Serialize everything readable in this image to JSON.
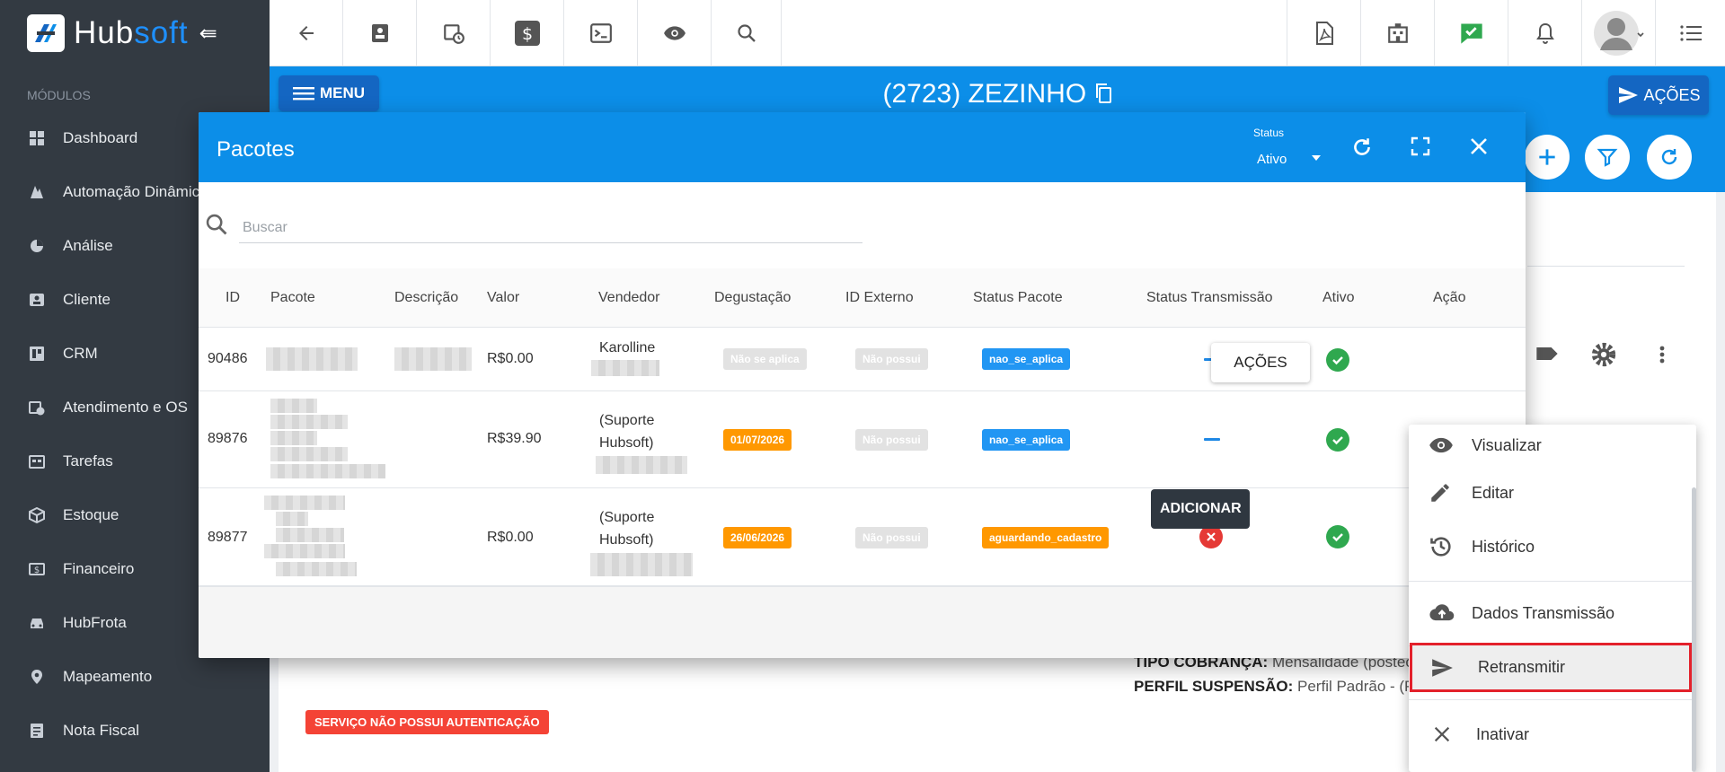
{
  "brand": {
    "name_a": "Hub",
    "name_b": "soft"
  },
  "sidebar": {
    "section": "MÓDULOS",
    "items": [
      {
        "label": "Dashboard",
        "icon": "dashboard-icon"
      },
      {
        "label": "Automação Dinâmica",
        "icon": "automation-icon"
      },
      {
        "label": "Análise",
        "icon": "pie-chart-icon"
      },
      {
        "label": "Cliente",
        "icon": "client-card-icon"
      },
      {
        "label": "CRM",
        "icon": "crm-board-icon"
      },
      {
        "label": "Atendimento e OS",
        "icon": "calendar-clock-icon"
      },
      {
        "label": "Tarefas",
        "icon": "tasks-icon"
      },
      {
        "label": "Estoque",
        "icon": "box-icon"
      },
      {
        "label": "Financeiro",
        "icon": "money-icon"
      },
      {
        "label": "HubFrota",
        "icon": "car-icon"
      },
      {
        "label": "Mapeamento",
        "icon": "map-pin-icon"
      },
      {
        "label": "Nota Fiscal",
        "icon": "invoice-icon"
      }
    ]
  },
  "header": {
    "menu_label": "MENU",
    "client_title": "(2723) ZEZINHO",
    "acoes_label": "AÇÕES"
  },
  "modal": {
    "title": "Pacotes",
    "status_label": "Status",
    "status_value": "Ativo",
    "search_placeholder": "Buscar",
    "columns": [
      "ID",
      "Pacote",
      "Descrição",
      "Valor",
      "Vendedor",
      "Degustação",
      "ID Externo",
      "Status Pacote",
      "Status Transmissão",
      "Ativo",
      "Ação"
    ],
    "rows": [
      {
        "id": "90486",
        "valor": "R$0.00",
        "vendedor": "Karolline",
        "degustacao": "Não se aplica",
        "id_externo": "Não possui",
        "status_pacote": "nao_se_aplica",
        "acao": "AÇÕES"
      },
      {
        "id": "89876",
        "valor": "R$39.90",
        "vendedor": "(Suporte Hubsoft)",
        "degustacao": "01/07/2026",
        "id_externo": "Não possui",
        "status_pacote": "nao_se_aplica"
      },
      {
        "id": "89877",
        "valor": "R$0.00",
        "vendedor": "(Suporte Hubsoft)",
        "degustacao": "26/06/2026",
        "id_externo": "Não possui",
        "status_pacote": "aguardando_cadastro"
      }
    ],
    "add_label": "ADICIONAR"
  },
  "dropdown": {
    "items": [
      {
        "label": "Visualizar",
        "icon": "eye-icon"
      },
      {
        "label": "Editar",
        "icon": "pencil-icon"
      },
      {
        "label": "Histórico",
        "icon": "history-icon"
      },
      {
        "label": "Dados Transmissão",
        "icon": "cloud-upload-icon"
      },
      {
        "label": "Retransmitir",
        "icon": "send-icon"
      },
      {
        "label": "Inativar",
        "icon": "close-icon"
      }
    ]
  },
  "background": {
    "tipo_cobranca_label": "TIPO COBRANÇA:",
    "tipo_cobranca_value": "Mensalidade (postec",
    "perfil_label": "PERFIL SUSPENSÃO:",
    "perfil_value": "Perfil Padrão - (Pa",
    "badge": "SERVIÇO NÃO POSSUI AUTENTICAÇÃO"
  },
  "colors": {
    "primary": "#0c8ee8",
    "primary_dark": "#1466c2",
    "sidebar": "#333a42",
    "success": "#2fa84f",
    "danger": "#e53935",
    "orange": "#ff9800",
    "highlight": "#e3212b"
  }
}
